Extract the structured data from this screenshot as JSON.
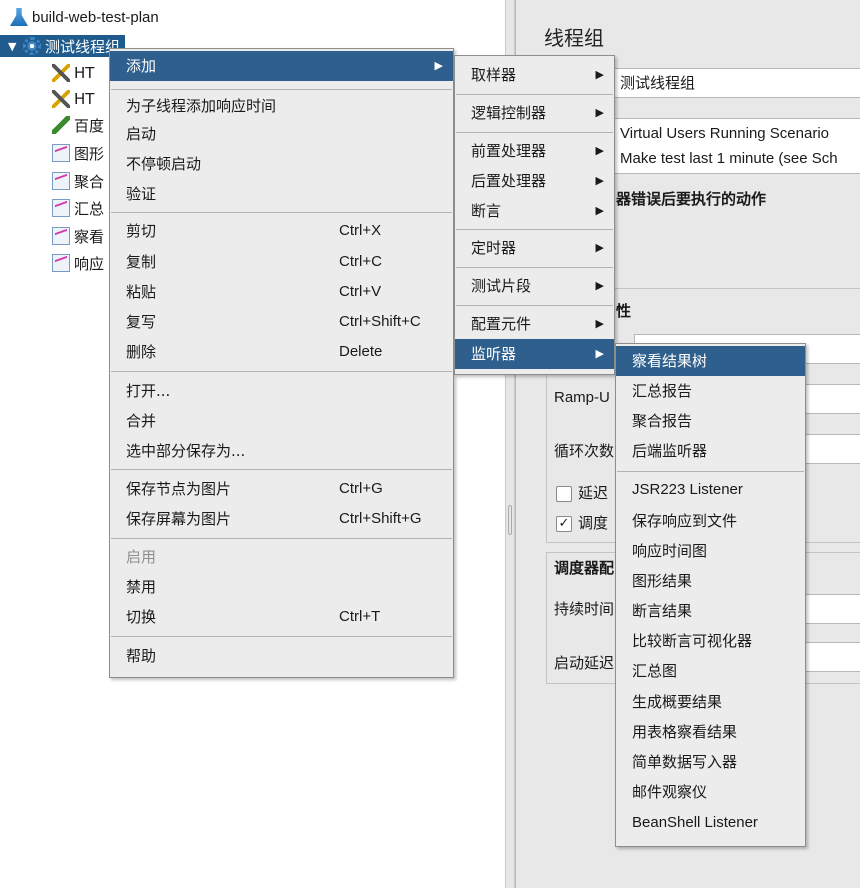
{
  "tree": {
    "plan_label": "build-web-test-plan",
    "thread_group_label": "测试线程组",
    "children": [
      "HT",
      "HT",
      "百度",
      "图形",
      "聚合",
      "汇总",
      "察看",
      "响应"
    ]
  },
  "panel": {
    "title": "线程组",
    "name_value": "测试线程组",
    "comment_line1": "Virtual Users Running Scenario",
    "comment_line2": "Make test last 1 minute (see Sch",
    "error_action_label": "器错误后要执行的动作",
    "thread_props_label": "性",
    "rampup_label": "Ramp-U",
    "loop_label": "循环次数",
    "delay_label": "延迟",
    "scheduler_label": "调度",
    "scheduler_config_label": "调度器配",
    "duration_label": "持续时间",
    "startup_delay_label": "启动延迟"
  },
  "context_menu": {
    "add": "添加",
    "add_response_time": "为子线程添加响应时间",
    "start": "启动",
    "start_no_pause": "不停顿启动",
    "validate": "验证",
    "cut": "剪切",
    "cut_shortcut": "Ctrl+X",
    "copy": "复制",
    "copy_shortcut": "Ctrl+C",
    "paste": "粘贴",
    "paste_shortcut": "Ctrl+V",
    "duplicate": "复写",
    "duplicate_shortcut": "Ctrl+Shift+C",
    "delete": "删除",
    "delete_shortcut": "Delete",
    "open": "打开...",
    "merge": "合并",
    "save_selection": "选中部分保存为...",
    "save_node_image": "保存节点为图片",
    "save_node_image_shortcut": "Ctrl+G",
    "save_screen_image": "保存屏幕为图片",
    "save_screen_image_shortcut": "Ctrl+Shift+G",
    "enable": "启用",
    "disable": "禁用",
    "toggle": "切换",
    "toggle_shortcut": "Ctrl+T",
    "help": "帮助"
  },
  "add_submenu": {
    "sampler": "取样器",
    "logic_controller": "逻辑控制器",
    "pre_processor": "前置处理器",
    "post_processor": "后置处理器",
    "assertion": "断言",
    "timer": "定时器",
    "test_fragment": "测试片段",
    "config_element": "配置元件",
    "listener": "监听器"
  },
  "listener_submenu": {
    "items": [
      "察看结果树",
      "汇总报告",
      "聚合报告",
      "后端监听器",
      "JSR223 Listener",
      "保存响应到文件",
      "响应时间图",
      "图形结果",
      "断言结果",
      "比较断言可视化器",
      "汇总图",
      "生成概要结果",
      "用表格察看结果",
      "简单数据写入器",
      "邮件观察仪",
      "BeanShell Listener"
    ]
  },
  "colors": {
    "highlight": "#2f5f8c",
    "tree_selection": "#1f5b8c",
    "menu_bg": "#ececec"
  }
}
